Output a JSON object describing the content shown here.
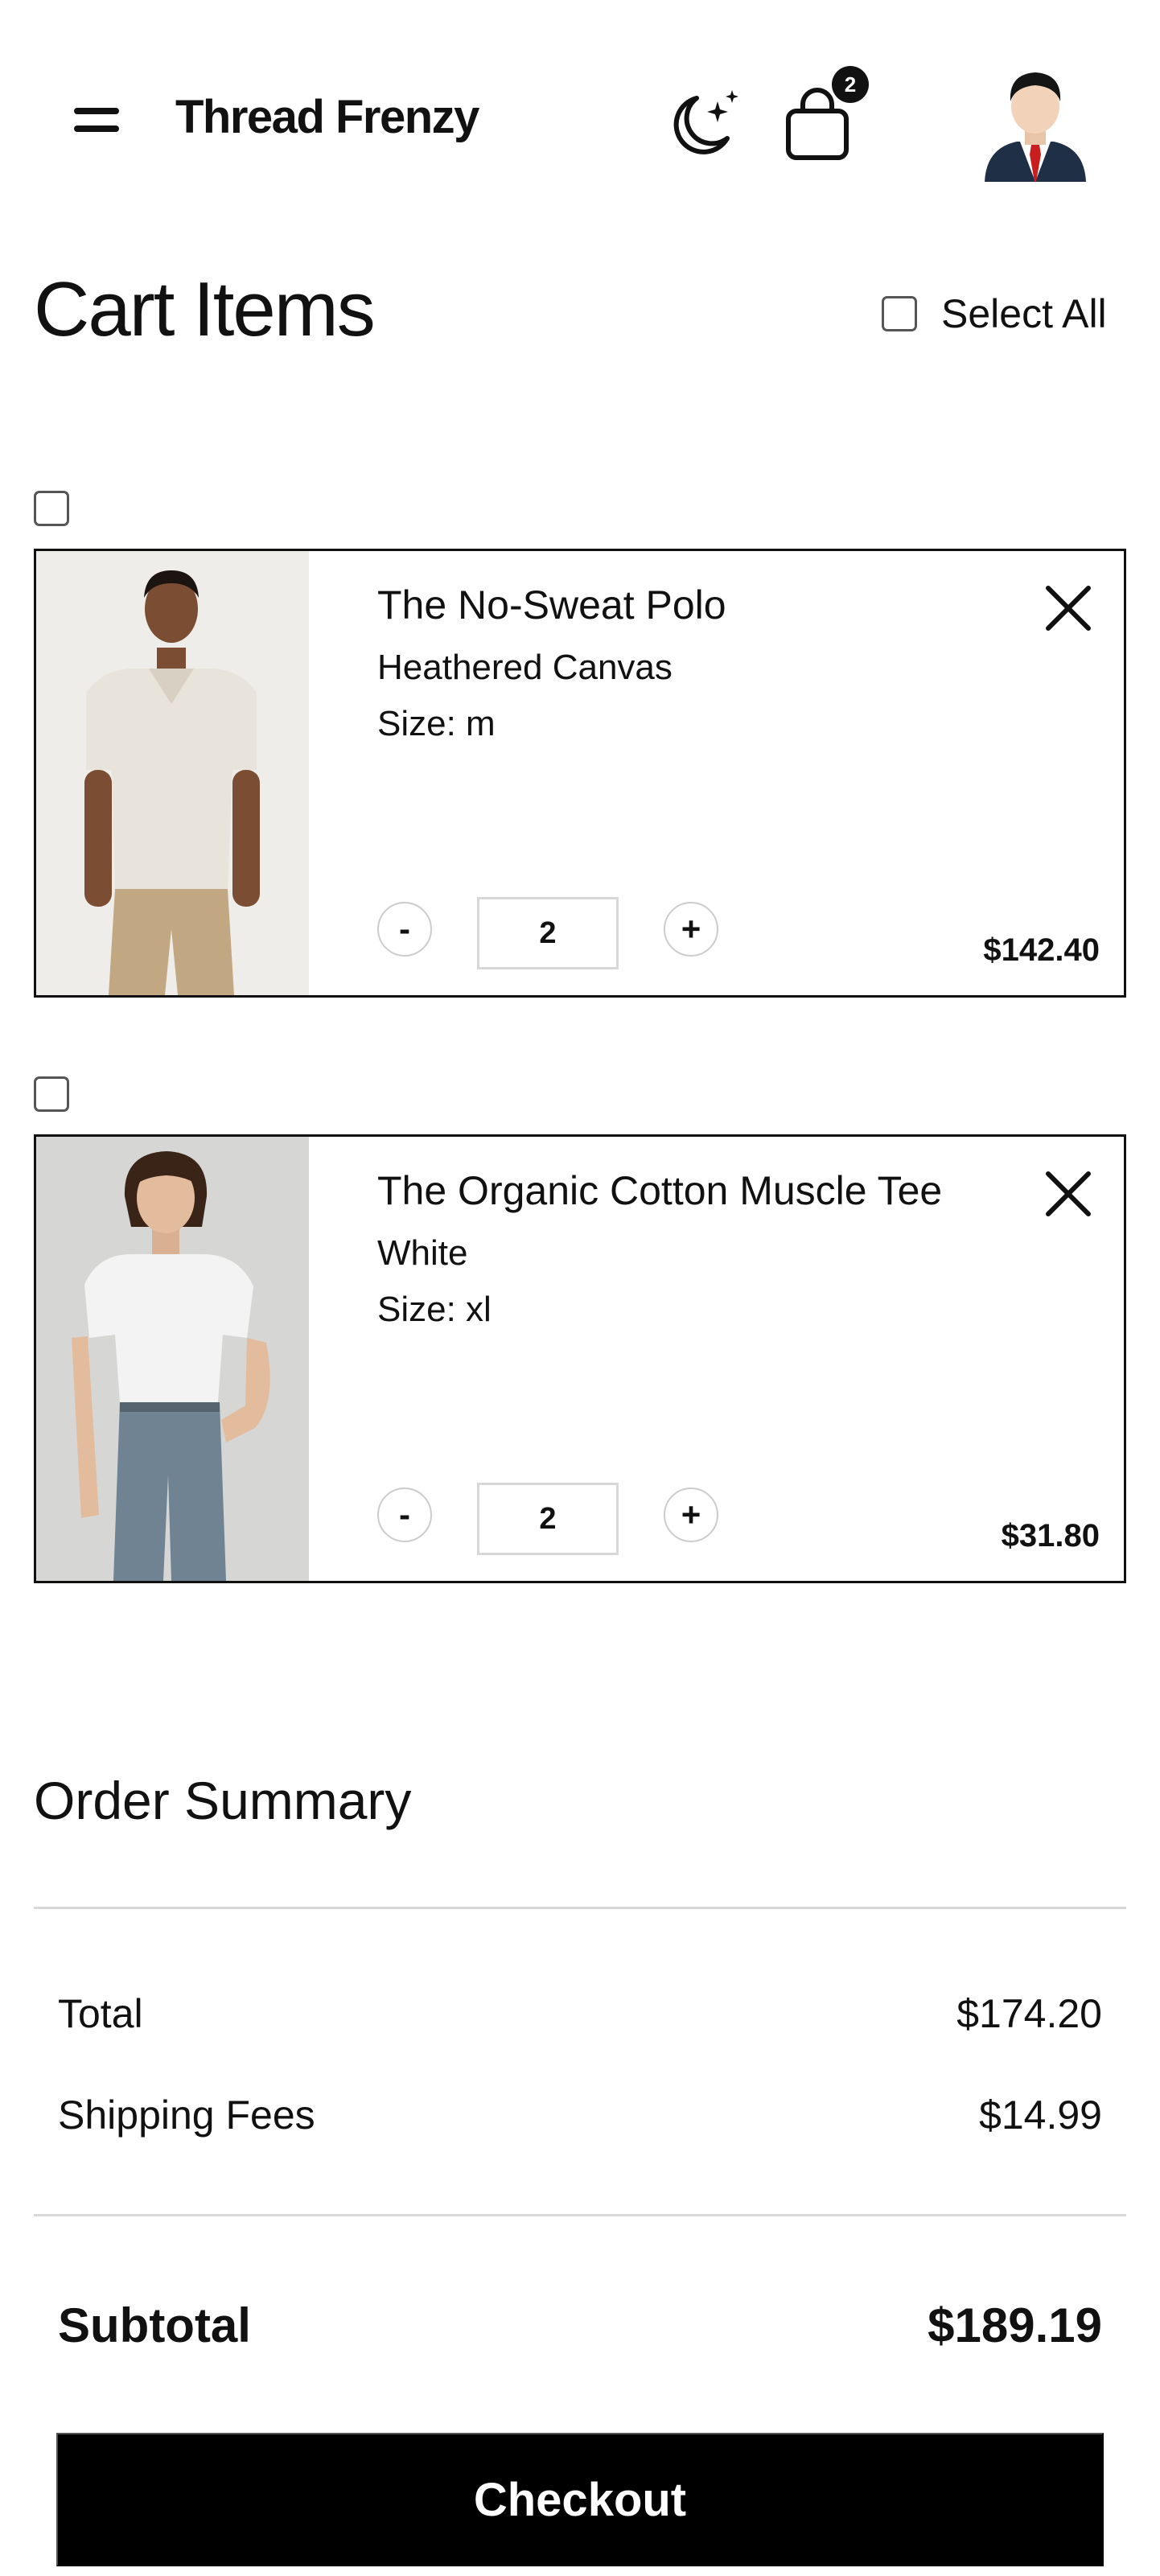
{
  "header": {
    "brand": "Thread Frenzy",
    "cart_count": "2",
    "icons": {
      "menu": "hamburger-icon",
      "theme": "moon-stars-icon",
      "cart": "shopping-bag-icon",
      "avatar": "user-avatar"
    }
  },
  "cart": {
    "title": "Cart Items",
    "select_all_label": "Select All",
    "items": [
      {
        "name": "The No-Sweat Polo",
        "color": "Heathered Canvas",
        "size": "Size: m",
        "quantity": "2",
        "price": "$142.40",
        "image": "man-in-beige-polo"
      },
      {
        "name": "The Organic Cotton Muscle Tee",
        "color": "White",
        "size": "Size: xl",
        "quantity": "2",
        "price": "$31.80",
        "image": "woman-in-white-tee"
      }
    ],
    "qty_minus_label": "-",
    "qty_plus_label": "+"
  },
  "summary": {
    "title": "Order Summary",
    "total_label": "Total",
    "total_value": "$174.20",
    "shipping_label": "Shipping Fees",
    "shipping_value": "$14.99",
    "subtotal_label": "Subtotal",
    "subtotal_value": "$189.19",
    "checkout_label": "Checkout"
  },
  "colors": {
    "text": "#111111",
    "button_bg": "#000000",
    "divider": "#d8d8d8",
    "avatar_suit": "#1f2f46",
    "avatar_tie": "#c81e1e"
  }
}
